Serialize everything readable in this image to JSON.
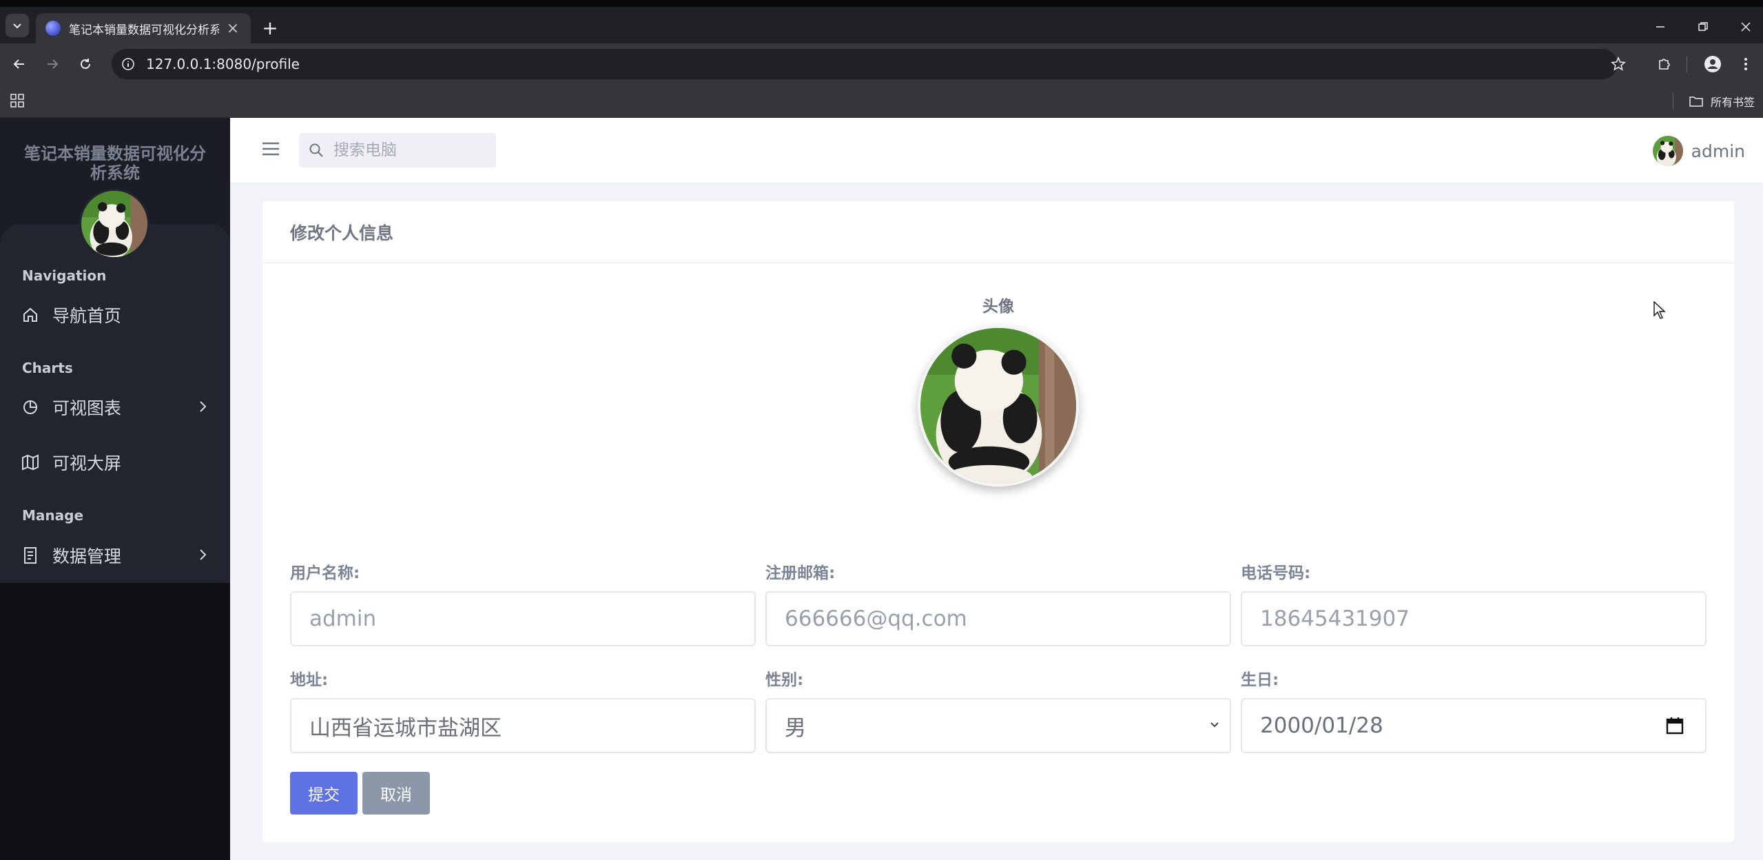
{
  "browser": {
    "tab_title": "笔记本销量数据可视化分析系统",
    "url": "127.0.0.1:8080/profile",
    "bookmarks_label": "所有书签"
  },
  "sidebar": {
    "brand": "笔记本销量数据可视化分析系统",
    "sections": [
      {
        "label": "Navigation",
        "items": [
          {
            "label": "导航首页",
            "icon": "home-icon"
          }
        ]
      },
      {
        "label": "Charts",
        "items": [
          {
            "label": "可视图表",
            "icon": "pie-chart-icon",
            "has_children": true
          },
          {
            "label": "可视大屏",
            "icon": "map-icon"
          }
        ]
      },
      {
        "label": "Manage",
        "items": [
          {
            "label": "数据管理",
            "icon": "document-icon",
            "has_children": true
          }
        ]
      }
    ]
  },
  "header": {
    "search_placeholder": "搜索电脑",
    "username": "admin"
  },
  "profile": {
    "title": "修改个人信息",
    "avatar_label": "头像",
    "fields": {
      "username": {
        "label": "用户名称:",
        "value": "admin"
      },
      "email": {
        "label": "注册邮箱:",
        "value": "666666@qq.com"
      },
      "phone": {
        "label": "电话号码:",
        "value": "18645431907"
      },
      "address": {
        "label": "地址:",
        "value": "山西省运城市盐湖区"
      },
      "gender": {
        "label": "性别:",
        "value": "男"
      },
      "birthday": {
        "label": "生日:",
        "value": "2000/01/28"
      }
    },
    "submit_label": "提交",
    "cancel_label": "取消"
  },
  "colors": {
    "primary": "#5e72e4",
    "secondary": "#8c98a9",
    "sidebar_bg": "#0f1117"
  }
}
